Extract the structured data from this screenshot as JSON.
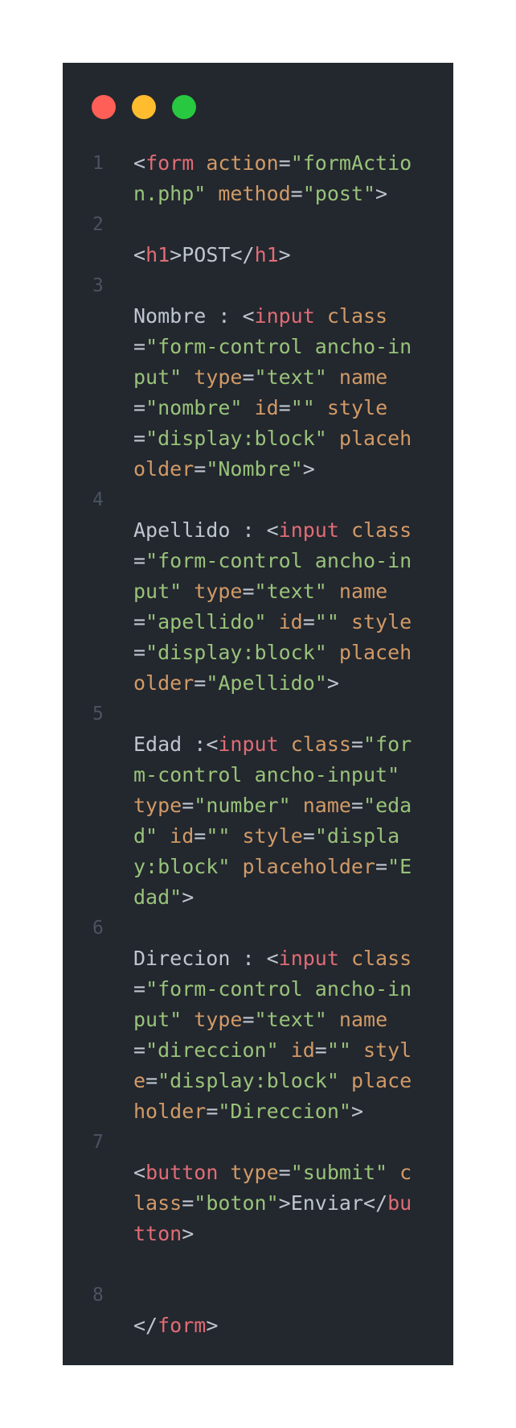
{
  "window": {
    "controls": [
      "close",
      "minimize",
      "maximize"
    ],
    "control_colors": {
      "close": "#ff5f57",
      "minimize": "#febc2e",
      "maximize": "#28c840"
    }
  },
  "colors": {
    "background": "#23272e",
    "tag": "#e06c75",
    "attribute": "#d19a66",
    "string": "#98c379",
    "text": "#bfc6d0",
    "gutter": "#4b5361"
  },
  "lines": [
    {
      "number": "1",
      "tokens": [
        {
          "t": "<",
          "k": "pun"
        },
        {
          "t": "form",
          "k": "tag"
        },
        {
          "t": " action",
          "k": "attr"
        },
        {
          "t": "=",
          "k": "pun"
        },
        {
          "t": "\"formAction.php\"",
          "k": "str"
        },
        {
          "t": " method",
          "k": "attr"
        },
        {
          "t": "=",
          "k": "pun"
        },
        {
          "t": "\"post\"",
          "k": "str"
        },
        {
          "t": ">",
          "k": "pun"
        }
      ]
    },
    {
      "number": "2",
      "tokens": [
        {
          "t": "<",
          "k": "pun"
        },
        {
          "t": "h1",
          "k": "tag"
        },
        {
          "t": ">",
          "k": "pun"
        },
        {
          "t": "POST",
          "k": "txt"
        },
        {
          "t": "</",
          "k": "pun"
        },
        {
          "t": "h1",
          "k": "tag"
        },
        {
          "t": ">",
          "k": "pun"
        }
      ]
    },
    {
      "number": "3",
      "tokens": [
        {
          "t": "Nombre : ",
          "k": "txt"
        },
        {
          "t": "<",
          "k": "pun"
        },
        {
          "t": "input",
          "k": "tag"
        },
        {
          "t": " class",
          "k": "attr"
        },
        {
          "t": "=",
          "k": "pun"
        },
        {
          "t": "\"form-control ancho-input\"",
          "k": "str"
        },
        {
          "t": " type",
          "k": "attr"
        },
        {
          "t": "=",
          "k": "pun"
        },
        {
          "t": "\"text\"",
          "k": "str"
        },
        {
          "t": " name",
          "k": "attr"
        },
        {
          "t": "=",
          "k": "pun"
        },
        {
          "t": "\"nombre\"",
          "k": "str"
        },
        {
          "t": " id",
          "k": "attr"
        },
        {
          "t": "=",
          "k": "pun"
        },
        {
          "t": "\"\"",
          "k": "str"
        },
        {
          "t": " style",
          "k": "attr"
        },
        {
          "t": "=",
          "k": "pun"
        },
        {
          "t": "\"display:block\"",
          "k": "str"
        },
        {
          "t": " placeholder",
          "k": "attr"
        },
        {
          "t": "=",
          "k": "pun"
        },
        {
          "t": "\"Nombre\"",
          "k": "str"
        },
        {
          "t": ">",
          "k": "pun"
        }
      ]
    },
    {
      "number": "4",
      "tokens": [
        {
          "t": "Apellido : ",
          "k": "txt"
        },
        {
          "t": "<",
          "k": "pun"
        },
        {
          "t": "input",
          "k": "tag"
        },
        {
          "t": " class",
          "k": "attr"
        },
        {
          "t": "=",
          "k": "pun"
        },
        {
          "t": "\"form-control ancho-input\"",
          "k": "str"
        },
        {
          "t": " type",
          "k": "attr"
        },
        {
          "t": "=",
          "k": "pun"
        },
        {
          "t": "\"text\"",
          "k": "str"
        },
        {
          "t": " name",
          "k": "attr"
        },
        {
          "t": "=",
          "k": "pun"
        },
        {
          "t": "\"apellido\"",
          "k": "str"
        },
        {
          "t": " id",
          "k": "attr"
        },
        {
          "t": "=",
          "k": "pun"
        },
        {
          "t": "\"\"",
          "k": "str"
        },
        {
          "t": " style",
          "k": "attr"
        },
        {
          "t": "=",
          "k": "pun"
        },
        {
          "t": "\"display:block\"",
          "k": "str"
        },
        {
          "t": " placeholder",
          "k": "attr"
        },
        {
          "t": "=",
          "k": "pun"
        },
        {
          "t": "\"Apellido\"",
          "k": "str"
        },
        {
          "t": ">",
          "k": "pun"
        }
      ]
    },
    {
      "number": "5",
      "tokens": [
        {
          "t": "Edad :",
          "k": "txt"
        },
        {
          "t": "<",
          "k": "pun"
        },
        {
          "t": "input",
          "k": "tag"
        },
        {
          "t": " class",
          "k": "attr"
        },
        {
          "t": "=",
          "k": "pun"
        },
        {
          "t": "\"form-control ancho-input\"",
          "k": "str"
        },
        {
          "t": " type",
          "k": "attr"
        },
        {
          "t": "=",
          "k": "pun"
        },
        {
          "t": "\"number\"",
          "k": "str"
        },
        {
          "t": " name",
          "k": "attr"
        },
        {
          "t": "=",
          "k": "pun"
        },
        {
          "t": "\"edad\"",
          "k": "str"
        },
        {
          "t": " id",
          "k": "attr"
        },
        {
          "t": "=",
          "k": "pun"
        },
        {
          "t": "\"\"",
          "k": "str"
        },
        {
          "t": " style",
          "k": "attr"
        },
        {
          "t": "=",
          "k": "pun"
        },
        {
          "t": "\"display:block\"",
          "k": "str"
        },
        {
          "t": " placeholder",
          "k": "attr"
        },
        {
          "t": "=",
          "k": "pun"
        },
        {
          "t": "\"Edad\"",
          "k": "str"
        },
        {
          "t": ">",
          "k": "pun"
        }
      ]
    },
    {
      "number": "6",
      "tokens": [
        {
          "t": "Direcion : ",
          "k": "txt"
        },
        {
          "t": "<",
          "k": "pun"
        },
        {
          "t": "input",
          "k": "tag"
        },
        {
          "t": " class",
          "k": "attr"
        },
        {
          "t": "=",
          "k": "pun"
        },
        {
          "t": "\"form-control ancho-input\"",
          "k": "str"
        },
        {
          "t": " type",
          "k": "attr"
        },
        {
          "t": "=",
          "k": "pun"
        },
        {
          "t": "\"text\"",
          "k": "str"
        },
        {
          "t": " name",
          "k": "attr"
        },
        {
          "t": "=",
          "k": "pun"
        },
        {
          "t": "\"direccion\"",
          "k": "str"
        },
        {
          "t": " id",
          "k": "attr"
        },
        {
          "t": "=",
          "k": "pun"
        },
        {
          "t": "\"\"",
          "k": "str"
        },
        {
          "t": " style",
          "k": "attr"
        },
        {
          "t": "=",
          "k": "pun"
        },
        {
          "t": "\"display:block\"",
          "k": "str"
        },
        {
          "t": " placeholder",
          "k": "attr"
        },
        {
          "t": "=",
          "k": "pun"
        },
        {
          "t": "\"Direccion\"",
          "k": "str"
        },
        {
          "t": ">",
          "k": "pun"
        }
      ]
    },
    {
      "number": "7",
      "tokens": [
        {
          "t": "<",
          "k": "pun"
        },
        {
          "t": "button",
          "k": "tag"
        },
        {
          "t": " type",
          "k": "attr"
        },
        {
          "t": "=",
          "k": "pun"
        },
        {
          "t": "\"submit\"",
          "k": "str"
        },
        {
          "t": " class",
          "k": "attr"
        },
        {
          "t": "=",
          "k": "pun"
        },
        {
          "t": "\"boton\"",
          "k": "str"
        },
        {
          "t": ">",
          "k": "pun"
        },
        {
          "t": "Enviar",
          "k": "txt"
        },
        {
          "t": "</",
          "k": "pun"
        },
        {
          "t": "button",
          "k": "tag"
        },
        {
          "t": ">",
          "k": "pun"
        }
      ]
    },
    {
      "number": "8",
      "tokens": [
        {
          "t": "</",
          "k": "pun"
        },
        {
          "t": "form",
          "k": "tag"
        },
        {
          "t": ">",
          "k": "pun"
        }
      ]
    }
  ]
}
